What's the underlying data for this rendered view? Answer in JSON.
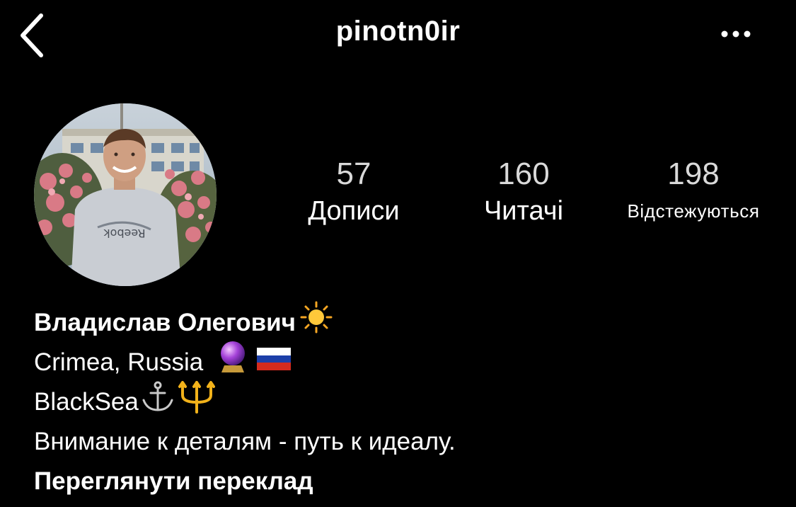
{
  "header": {
    "username": "pinotn0ir",
    "back_icon": "chevron-left-icon",
    "more_icon": "more-horizontal-icon"
  },
  "profile": {
    "avatar_alt": "profile-photo",
    "stats": {
      "posts_count": "57",
      "posts_label": "Дописи",
      "followers_count": "160",
      "followers_label": "Читачі",
      "following_count": "198",
      "following_label": "Відстежуються"
    }
  },
  "bio": {
    "name": "Владислав Олегович",
    "name_emoji": "sun-icon",
    "location": "Crimea, Russia",
    "location_emojis": [
      "crystal-ball-icon",
      "russia-flag-icon"
    ],
    "line2": "BlackSea",
    "line2_emojis": [
      "anchor-icon",
      "trident-icon"
    ],
    "line3": "Внимание к деталям - путь к идеалу.",
    "translate_label": "Переглянути переклад"
  },
  "colors": {
    "background": "#000000",
    "text": "#ffffff",
    "count_text": "#d9d9d9"
  }
}
